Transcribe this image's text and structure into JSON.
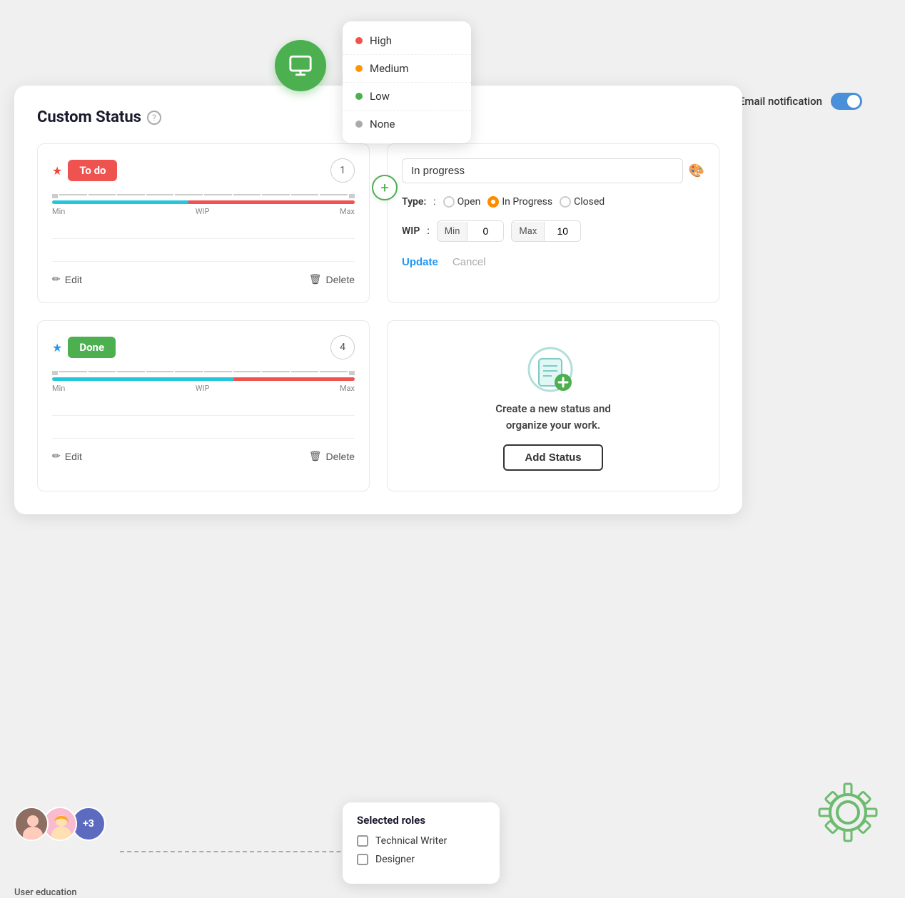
{
  "header": {
    "title": "Custom Status",
    "help_label": "?",
    "email_notification_label": "Email notification",
    "toggle_on": true
  },
  "floating_button": {
    "icon": "monitor"
  },
  "priority_dropdown": {
    "items": [
      {
        "label": "High",
        "color": "#ef5350"
      },
      {
        "label": "Medium",
        "color": "#ff9800"
      },
      {
        "label": "Low",
        "color": "#4CAF50"
      },
      {
        "label": "None",
        "color": "#aaa"
      }
    ]
  },
  "status_cards": [
    {
      "badge_label": "To do",
      "badge_class": "badge-todo",
      "count": "1",
      "edit_label": "Edit",
      "delete_label": "Delete",
      "star_color": "red"
    },
    {
      "badge_label": "Done",
      "badge_class": "badge-done",
      "count": "4",
      "edit_label": "Edit",
      "delete_label": "Delete",
      "star_color": "blue"
    }
  ],
  "edit_form": {
    "input_value": "In progress",
    "type_label": "Type:",
    "types": [
      {
        "label": "Open",
        "checked": false
      },
      {
        "label": "In Progress",
        "checked": true
      },
      {
        "label": "Closed",
        "checked": false
      }
    ],
    "wip_label": "WIP",
    "min_label": "Min",
    "min_value": "0",
    "max_label": "Max",
    "max_value": "10",
    "update_label": "Update",
    "cancel_label": "Cancel"
  },
  "add_status_card": {
    "description": "Create a new status and\norganize your work.",
    "button_label": "Add Status"
  },
  "plus_button_label": "+",
  "bottom": {
    "user_education_label": "User education",
    "more_count": "+3",
    "roles_popup_title": "Selected roles",
    "roles": [
      {
        "label": "Technical Writer"
      },
      {
        "label": "Designer"
      }
    ]
  },
  "wip_bar_labels": {
    "min": "Min",
    "wip": "WIP",
    "max": "Max"
  }
}
